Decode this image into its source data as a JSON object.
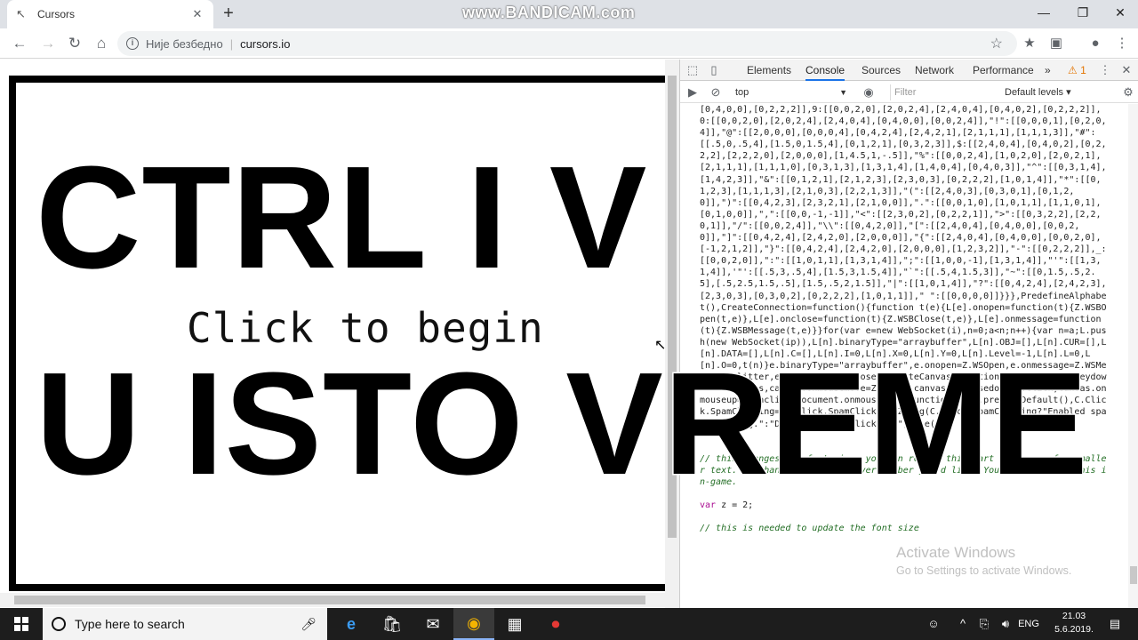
{
  "watermark": "www.BANDICAM.com",
  "browser": {
    "tab_title": "Cursors",
    "new_tab_label": "+",
    "address": {
      "security_text": "Није безбедно",
      "url": "cursors.io"
    },
    "window_controls": {
      "minimize": "—",
      "restore": "❐",
      "close": "✕"
    }
  },
  "page": {
    "click_prompt": "Click to begin"
  },
  "overlay": {
    "line1": "CTRL I V",
    "line2": "U ISTO VREME"
  },
  "devtools": {
    "tabs": [
      "Elements",
      "Console",
      "Sources",
      "Network",
      "Performance"
    ],
    "active_tab": "Console",
    "more_tabs": "»",
    "warning_count": "1",
    "context": "top",
    "filter_placeholder": "Filter",
    "levels_label": "Default levels ▾",
    "console_code": "[0,4,0,0],[0,2,2,2]],9:[[0,0,2,0],[2,0,2,4],[2,4,0,4],[0,4,0,2],[0,2,2,2]],0:[[0,0,2,0],[2,0,2,4],[2,4,0,4],[0,4,0,0],[0,0,2,4]],\"!\":[[0,0,0,1],[0,2,0,4]],\"@\":[[2,0,0,0],[0,0,0,4],[0,4,2,4],[2,4,2,1],[2,1,1,1],[1,1,1,3]],\"#\":[[.5,0,.5,4],[1.5,0,1.5,4],[0,1,2,1],[0,3,2,3]],$:[[2,4,0,4],[0,4,0,2],[0,2,2,2],[2,2,2,0],[2,0,0,0],[1,4.5,1,-.5]],\"%\":[[0,0,2,4],[1,0,2,0],[2,0,2,1],[2,1,1,1],[1,1,1,0],[0,3,1,3],[1,3,1,4],[1,4,0,4],[0,4,0,3]],\"^\":[[0,3,1,4],[1,4,2,3]],\"&\":[[0,1,2,1],[2,1,2,3],[2,3,0,3],[0,2,2,2],[1,0,1,4]],\"*\":[[0,1,2,3],[1,1,1,3],[2,1,0,3],[2,2,1,3]],\"(\":[[2,4,0,3],[0,3,0,1],[0,1,2,0]],\")\":[[0,4,2,3],[2,3,2,1],[2,1,0,0]],\".\":[[0,0,1,0],[1,0,1,1],[1,1,0,1],[0,1,0,0]],\",\":[[0,0,-1,-1]],\"<\":[[2,3,0,2],[0,2,2,1]],\">\":[[0,3,2,2],[2,2,0,1]],\"/\":[[0,0,2,4]],\"\\\\\":[[0,4,2,0]],\"[\":[[2,4,0,4],[0,4,0,0],[0,0,2,0]],\"]\":[[0,4,2,4],[2,4,2,0],[2,0,0,0]],\"{\":[[2,4,0,4],[0,4,0,0],[0,0,2,0],[-1,2,1,2]],\"}\":[[0,4,2,4],[2,4,2,0],[2,0,0,0],[1,2,3,2]],\"-\":[[0,2,2,2]],_:[[0,0,2,0]],\":\":[[1,0,1,1],[1,3,1,4]],\";\":[[1,0,0,-1],[1,3,1,4]],\"'\":[[1,3,1,4]],'\"':[[.5,3,.5,4],[1.5,3,1.5,4]],\"`\":[[.5,4,1.5,3]],\"~\":[[0,1.5,.5,2.5],[.5,2.5,1.5,.5],[1.5,.5,2,1.5]],\"|\":[[1,0,1,4]],\"?\":[[0,4,2,4],[2,4,2,3],[2,3,0,3],[0,3,0,2],[0,2,2,2],[1,0,1,1]],\" \":[[0,0,0,0]]}}},PredefineAlphabet(),CreateConnection=function(){function t(e){L[e].onopen=function(t){Z.WSBOpen(t,e)},L[e].onclose=function(t){Z.WSBClose(t,e)},L[e].onmessage=function(t){Z.WSBMessage(t,e)}}for(var e=new WebSocket(i),n=0;a<n;n++){var n=a;L.push(new WebSocket(ip)),L[n].binaryType=\"arraybuffer\",L[n].OBJ=[],L[n].CUR=[],L[n].DATA=[],L[n].C=[],L[n].I=0,L[n].X=0,L[n].Y=0,L[n].Level=-1,L[n].L=0,L[n].O=0,t(n)}e.binaryType=\"arraybuffer\",e.onopen=Z.WSOpen,e.onmessage=Z.WSMessageSplitter,e.onclose=Z.WSClose},CreateCanvas=function(){document.onkeydown=Z.Keypress,canvas.onmousemove=Z.Mouse,canvas.onmousedown=Z.Click,canvas.onmouseup=Z.Unclick,document.onmousedown=function(e){e.preventDefault(),C.Click.SpamClicking=!C.Click.SpamClicking,Z.Log(C.Click.SpamClicking?\"Enabled spam clicking.\":\"Disabled spam clicking.\")},le();",
    "comment1": "// this changes the font size, you can remove this part if you prefer smaller text. Or change \"z\" to whatever number you'd like. You can't change this in-game.",
    "code_keyword": "var",
    "code_rest": " z = 2;",
    "comment2": "// this is needed to update the font size"
  },
  "activation": {
    "title": "Activate Windows",
    "subtitle": "Go to Settings to activate Windows."
  },
  "taskbar": {
    "search_placeholder": "Type here to search",
    "language": "ENG",
    "time": "21.03",
    "date": "5.6.2019."
  }
}
